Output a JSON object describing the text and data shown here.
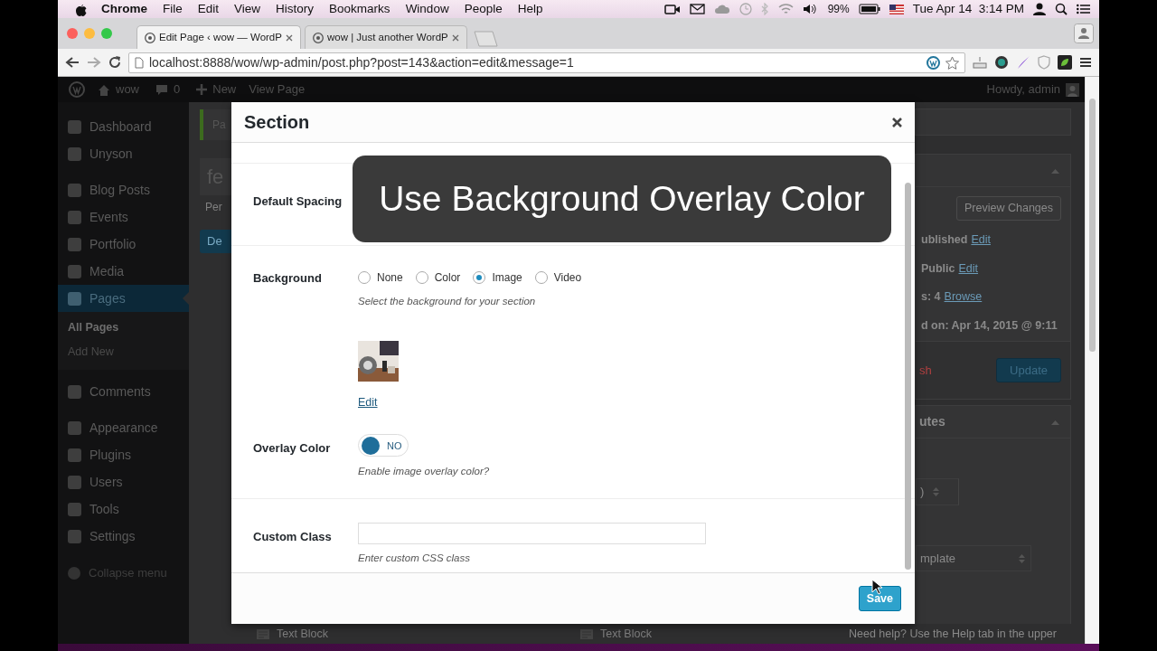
{
  "menubar": {
    "app": "Chrome",
    "menus": [
      "File",
      "Edit",
      "View",
      "History",
      "Bookmarks",
      "Window",
      "People",
      "Help"
    ],
    "battery": "99%",
    "clock": "Tue Apr 14  3:14 PM"
  },
  "tabs": [
    {
      "title": "Edit Page ‹ wow — WordP",
      "selected": true
    },
    {
      "title": "wow | Just another WordP",
      "selected": false
    }
  ],
  "address": "localhost:8888/wow/wp-admin/post.php?post=143&action=edit&message=1",
  "admin_bar": {
    "site": "wow",
    "comments": "0",
    "new": "New",
    "view": "View Page",
    "howdy": "Howdy, admin"
  },
  "sidebar": {
    "groups": [
      {
        "items": [
          {
            "label": "Dashboard",
            "selected": false
          },
          {
            "label": "Unyson",
            "selected": false
          }
        ]
      },
      {
        "items": [
          {
            "label": "Blog Posts",
            "selected": false
          },
          {
            "label": "Events",
            "selected": false
          },
          {
            "label": "Portfolio",
            "selected": false
          },
          {
            "label": "Media",
            "selected": false
          },
          {
            "label": "Pages",
            "selected": true,
            "children": [
              {
                "label": "All Pages",
                "selected": true
              },
              {
                "label": "Add New",
                "selected": false
              }
            ]
          }
        ]
      },
      {
        "items": [
          {
            "label": "Comments",
            "selected": false
          }
        ]
      },
      {
        "items": [
          {
            "label": "Appearance",
            "selected": false
          },
          {
            "label": "Plugins",
            "selected": false
          },
          {
            "label": "Users",
            "selected": false
          },
          {
            "label": "Tools",
            "selected": false
          },
          {
            "label": "Settings",
            "selected": false
          }
        ]
      }
    ],
    "collapse": "Collapse menu"
  },
  "background": {
    "notice": "Pa",
    "title_input": "fe",
    "permalink": "Per",
    "button": "De",
    "preview_button": "Preview Changes",
    "meta": [
      {
        "text": "ublished",
        "link": "Edit"
      },
      {
        "text": "Public",
        "link": "Edit"
      },
      {
        "text": "s: 4",
        "link": "Browse"
      },
      {
        "text": "d on: Apr 14, 2015 @ 9:11"
      }
    ],
    "trash": "sh",
    "update_button": "Update",
    "attributes_title": "utes",
    "parent_select": ")",
    "template_select": "mplate",
    "blocks": [
      "Text Block",
      "Text Block"
    ],
    "help": "Need help? Use the Help tab in the upper"
  },
  "modal": {
    "title": "Section",
    "sections": [
      {
        "fields": [
          {
            "kind": "covered",
            "label": "Default Spacing"
          }
        ]
      },
      {
        "fields": [
          {
            "kind": "radios",
            "label": "Background",
            "options": [
              {
                "label": "None",
                "selected": false
              },
              {
                "label": "Color",
                "selected": false
              },
              {
                "label": "Image",
                "selected": true
              },
              {
                "label": "Video",
                "selected": false
              }
            ],
            "help": "Select the background for your section",
            "image": {
              "kind": "picture"
            },
            "image_link": "Edit"
          },
          {
            "kind": "toggle",
            "label": "Overlay Color",
            "on": false,
            "state_text": "NO",
            "help": "Enable image overlay color?"
          }
        ]
      },
      {
        "fields": [
          {
            "kind": "input",
            "label": "Custom Class",
            "help": "Enter custom CSS class"
          }
        ]
      }
    ],
    "save": "Save"
  },
  "caption": "Use Background Overlay Color"
}
